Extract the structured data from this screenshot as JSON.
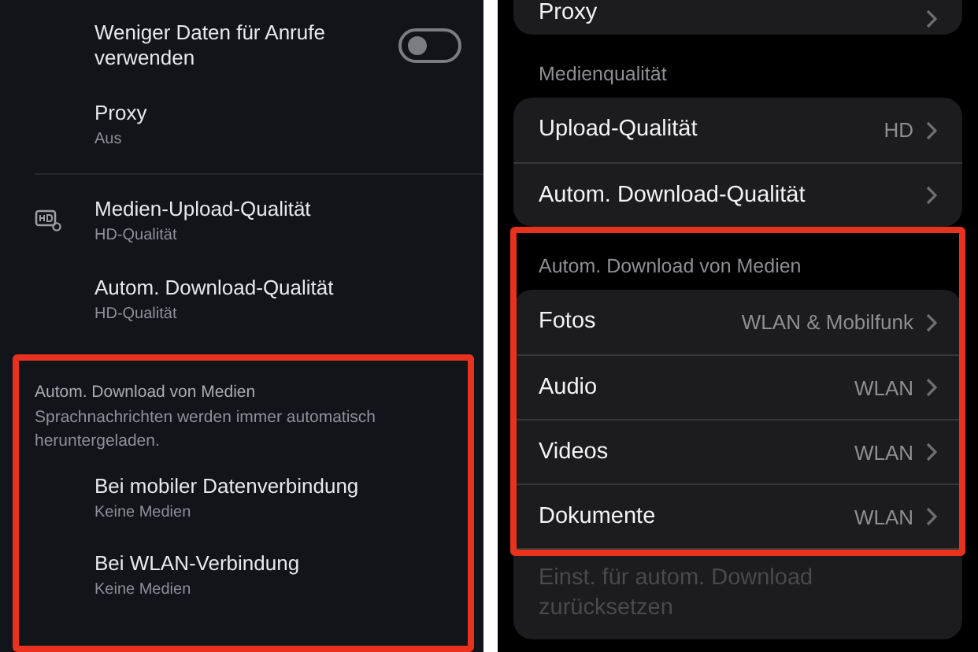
{
  "android": {
    "groups": [
      {
        "items": [
          {
            "kind": "toggle",
            "title": "Weniger Daten für Anrufe verwenden",
            "on": false
          },
          {
            "kind": "entry",
            "title": "Proxy",
            "subtitle": "Aus"
          }
        ]
      },
      {
        "items": [
          {
            "kind": "icon_entry",
            "title": "Medien-Upload-Qualität",
            "subtitle": "HD-Qualität"
          },
          {
            "kind": "entry",
            "title": "Autom. Download-Qualität",
            "subtitle": "HD-Qualität"
          }
        ]
      }
    ],
    "media_section": {
      "highlighted": true,
      "title": "Autom. Download von Medien",
      "description": "Sprachnachrichten werden immer automatisch heruntergeladen.",
      "items": [
        {
          "title": "Bei mobiler Datenverbindung",
          "subtitle": "Keine Medien"
        },
        {
          "title": "Bei WLAN-Verbindung",
          "subtitle": "Keine Medien"
        }
      ]
    }
  },
  "ios": {
    "top_card": {
      "label": "Proxy"
    },
    "sections": [
      {
        "header": "Medienqualität",
        "highlighted": false,
        "rows": [
          {
            "label": "Upload-Qualität",
            "value": "HD"
          },
          {
            "label": "Autom. Download-Qualität"
          }
        ]
      },
      {
        "header": "Autom. Download von Medien",
        "highlighted": true,
        "rows": [
          {
            "label": "Fotos",
            "value": "WLAN & Mobilfunk"
          },
          {
            "label": "Audio",
            "value": "WLAN"
          },
          {
            "label": "Videos",
            "value": "WLAN"
          },
          {
            "label": "Dokumente",
            "value": "WLAN"
          }
        ],
        "footer_row": {
          "label": "Einst. für autom. Download zurücksetzen",
          "disabled": true
        }
      }
    ]
  }
}
